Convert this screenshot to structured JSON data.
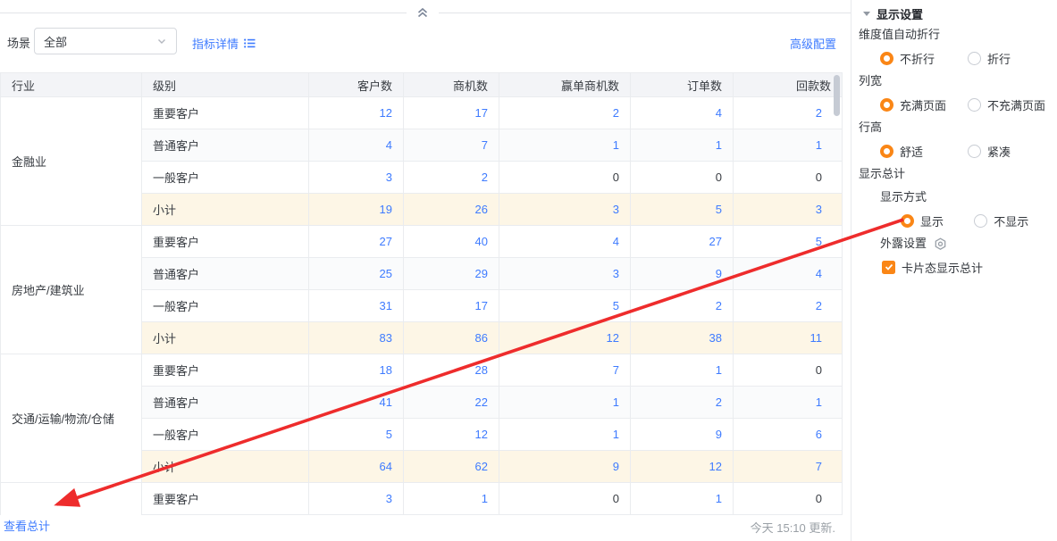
{
  "toolbar": {
    "scene_label": "场景",
    "scene_value": "全部",
    "metric_detail": "指标详情",
    "advanced_config": "高级配置"
  },
  "table": {
    "columns": [
      "行业",
      "级别",
      "客户数",
      "商机数",
      "赢单商机数",
      "订单数",
      "回款数"
    ],
    "subtotal_label": "小计",
    "groups": [
      {
        "industry": "金融业",
        "rows": [
          {
            "level": "重要客户",
            "values": [
              "12",
              "17",
              "2",
              "4",
              "2"
            ]
          },
          {
            "level": "普通客户",
            "values": [
              "4",
              "7",
              "1",
              "1",
              "1"
            ]
          },
          {
            "level": "一般客户",
            "values": [
              "3",
              "2",
              "0",
              "0",
              "0"
            ]
          },
          {
            "level": "小计",
            "values": [
              "19",
              "26",
              "3",
              "5",
              "3"
            ]
          }
        ]
      },
      {
        "industry": "房地产/建筑业",
        "rows": [
          {
            "level": "重要客户",
            "values": [
              "27",
              "40",
              "4",
              "27",
              "5"
            ]
          },
          {
            "level": "普通客户",
            "values": [
              "25",
              "29",
              "3",
              "9",
              "4"
            ]
          },
          {
            "level": "一般客户",
            "values": [
              "31",
              "17",
              "5",
              "2",
              "2"
            ]
          },
          {
            "level": "小计",
            "values": [
              "83",
              "86",
              "12",
              "38",
              "11"
            ]
          }
        ]
      },
      {
        "industry": "交通/运输/物流/仓储",
        "rows": [
          {
            "level": "重要客户",
            "values": [
              "18",
              "28",
              "7",
              "1",
              "0"
            ]
          },
          {
            "level": "普通客户",
            "values": [
              "41",
              "22",
              "1",
              "2",
              "1"
            ]
          },
          {
            "level": "一般客户",
            "values": [
              "5",
              "12",
              "1",
              "9",
              "6"
            ]
          },
          {
            "level": "小计",
            "values": [
              "64",
              "62",
              "9",
              "12",
              "7"
            ]
          }
        ]
      },
      {
        "industry": "",
        "rows": [
          {
            "level": "重要客户",
            "values": [
              "3",
              "1",
              "0",
              "1",
              "0"
            ]
          }
        ]
      }
    ]
  },
  "footer": {
    "view_total": "查看总计",
    "updated": "今天 15:10 更新."
  },
  "panel": {
    "title": "显示设置",
    "groups": [
      {
        "label": "维度值自动折行",
        "indent": false,
        "options": [
          {
            "text": "不折行",
            "selected": true
          },
          {
            "text": "折行",
            "selected": false
          }
        ]
      },
      {
        "label": "列宽",
        "indent": false,
        "options": [
          {
            "text": "充满页面",
            "selected": true
          },
          {
            "text": "不充满页面",
            "selected": false
          }
        ]
      },
      {
        "label": "行高",
        "indent": false,
        "options": [
          {
            "text": "舒适",
            "selected": true
          },
          {
            "text": "紧凑",
            "selected": false
          }
        ]
      },
      {
        "label": "显示总计",
        "indent": false,
        "options": []
      },
      {
        "label": "显示方式",
        "indent": true,
        "options": [
          {
            "text": "显示",
            "selected": true
          },
          {
            "text": "不显示",
            "selected": false
          }
        ]
      }
    ],
    "expose_label": "外露设置",
    "card_total": {
      "label": "卡片态显示总计",
      "checked": true
    }
  },
  "colors": {
    "accent_orange": "#fa8616",
    "link_blue": "#3e7bff",
    "arrow_red": "#ee2c2c",
    "subtotal_bg": "#fdf6e6"
  }
}
